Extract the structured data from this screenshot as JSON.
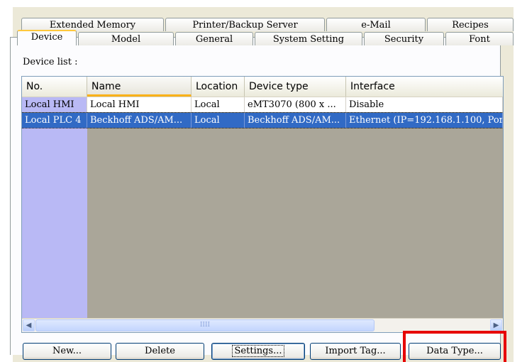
{
  "tabs_row_back": [
    {
      "label": "Extended Memory"
    },
    {
      "label": "Printer/Backup Server"
    },
    {
      "label": "e-Mail"
    },
    {
      "label": "Recipes"
    }
  ],
  "tabs_row_front": [
    {
      "label": "Device",
      "active": true
    },
    {
      "label": "Model"
    },
    {
      "label": "General"
    },
    {
      "label": "System Setting"
    },
    {
      "label": "Security"
    },
    {
      "label": "Font"
    }
  ],
  "device_list": {
    "label": "Device list :",
    "columns": [
      "No.",
      "Name",
      "Location",
      "Device type",
      "Interface"
    ],
    "rows": [
      [
        "Local HMI",
        "Local HMI",
        "Local",
        "eMT3070 (800 x ...",
        "Disable"
      ],
      [
        "Local PLC 4",
        "Beckhoff ADS/AM...",
        "Local",
        "Beckhoff ADS/AM...",
        "Ethernet (IP=192.168.1.100, Por"
      ]
    ],
    "scroll_grip": "IIII"
  },
  "buttons": {
    "new": "New...",
    "delete": "Delete",
    "settings": "Settings...",
    "import_tag": "Import Tag...",
    "data_type": "Data Type..."
  },
  "colors": {
    "highlight": "#e60000",
    "selection": "#316ac5",
    "tab_accent": "#ffc83c"
  }
}
